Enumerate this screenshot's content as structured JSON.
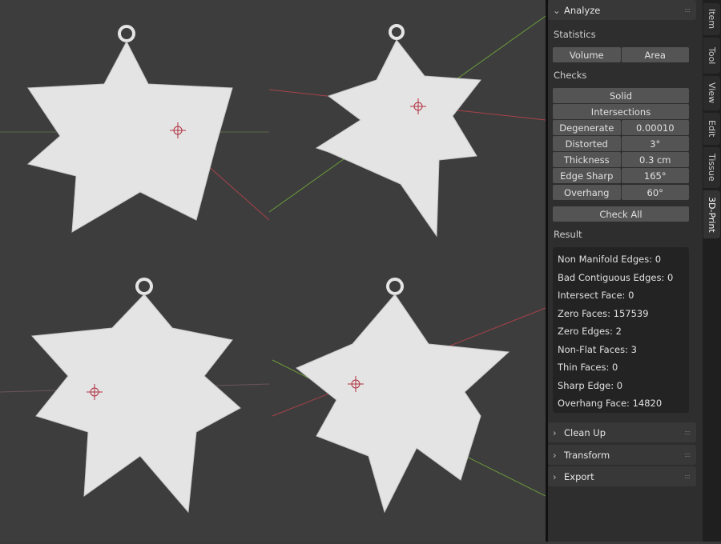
{
  "panel": {
    "analyze": "Analyze",
    "statistics": "Statistics",
    "volume": "Volume",
    "area": "Area",
    "checks": "Checks",
    "solid": "Solid",
    "intersections": "Intersections",
    "params": [
      {
        "label": "Degenerate",
        "value": "0.00010"
      },
      {
        "label": "Distorted",
        "value": "3°"
      },
      {
        "label": "Thickness",
        "value": "0.3 cm"
      },
      {
        "label": "Edge Sharp",
        "value": "165°"
      },
      {
        "label": "Overhang",
        "value": "60°"
      }
    ],
    "check_all": "Check All",
    "result": "Result",
    "results": [
      "Non Manifold Edges: 0",
      "Bad Contiguous Edges: 0",
      "Intersect Face: 0",
      "Zero Faces: 157539",
      "Zero Edges: 2",
      "Non-Flat Faces: 3",
      "Thin Faces: 0",
      "Sharp Edge: 0",
      "Overhang Face: 14820"
    ],
    "clean_up": "Clean Up",
    "transform": "Transform",
    "export": "Export"
  },
  "tabs": [
    "Item",
    "Tool",
    "View",
    "Edit",
    "Tissue",
    "3D-Print"
  ],
  "colors": {
    "x_axis": "#a8424a",
    "y_axis": "#6a9a3a",
    "model": "#e6e6e6"
  }
}
